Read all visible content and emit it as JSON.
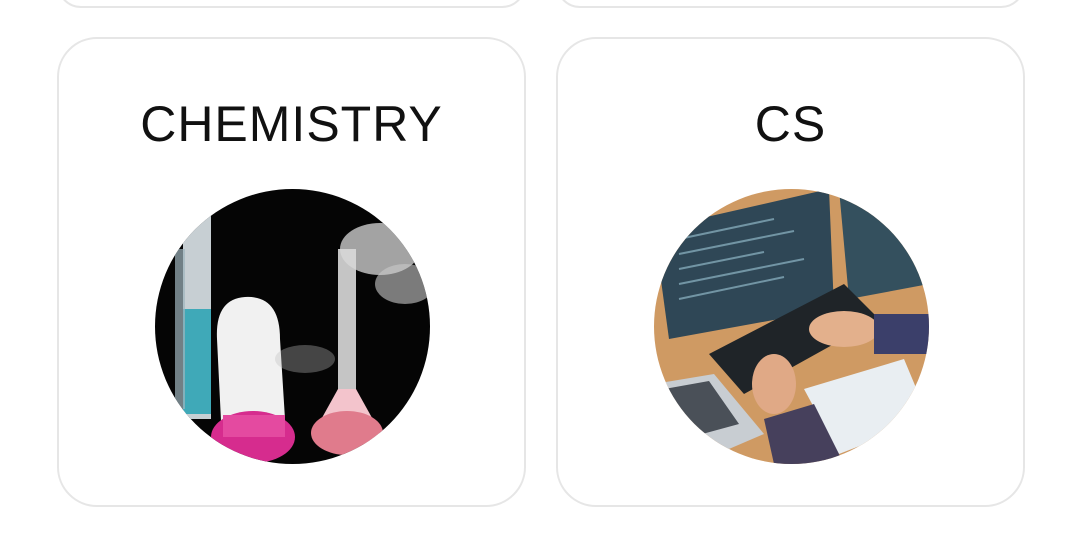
{
  "cards": [
    {
      "title": "CHEMISTRY",
      "image": "chemistry-lab-glassware-image"
    },
    {
      "title": "CS",
      "image": "programmer-keyboard-image"
    }
  ]
}
